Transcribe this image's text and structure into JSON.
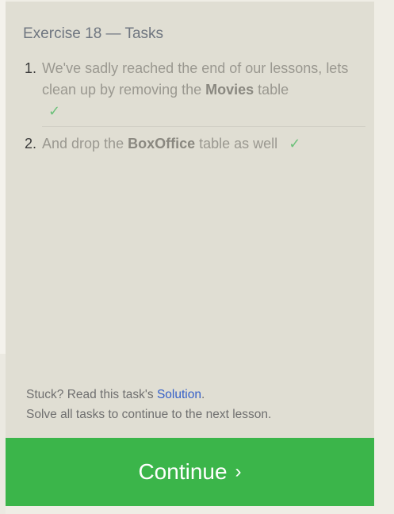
{
  "panel": {
    "title": "Exercise 18 — Tasks"
  },
  "tasks": [
    {
      "number": "1.",
      "text_before": "We've sadly reached the end of our lessons, lets clean up by removing the ",
      "bold": "Movies",
      "text_after": " table",
      "completed": true,
      "check_icon": "✓"
    },
    {
      "number": "2.",
      "text_before": "And drop the ",
      "bold": "BoxOffice",
      "text_after": " table as well",
      "completed": true,
      "check_icon": "✓"
    }
  ],
  "hints": {
    "stuck_prefix": "Stuck? Read this task's ",
    "solution_link": "Solution",
    "stuck_suffix": ".",
    "continue_hint": "Solve all tasks to continue to the next lesson."
  },
  "continue_button": {
    "label": "Continue",
    "chevron": "›"
  },
  "colors": {
    "panel_bg": "#e0ded3",
    "accent_green": "#3bb54a",
    "check_green": "#6cc17a",
    "link_blue": "#3560c8"
  }
}
